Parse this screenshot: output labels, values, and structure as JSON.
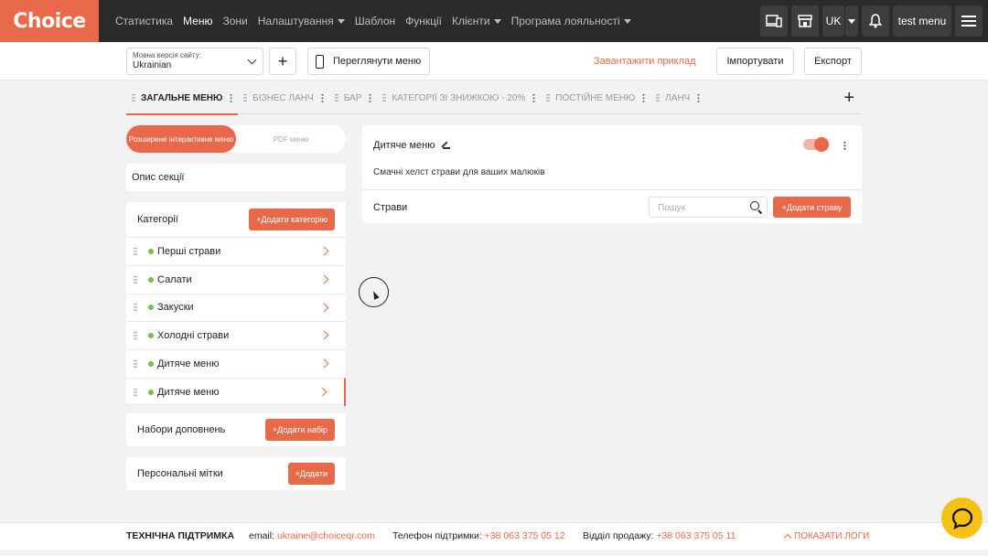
{
  "brand": {
    "logo_text": "Choice",
    "accent": "#e8694a"
  },
  "nav": {
    "items": [
      {
        "label": "Статистика",
        "active": false,
        "has_dropdown": false
      },
      {
        "label": "Меню",
        "active": true,
        "has_dropdown": false
      },
      {
        "label": "Зони",
        "active": false,
        "has_dropdown": false
      },
      {
        "label": "Налаштування",
        "active": false,
        "has_dropdown": true
      },
      {
        "label": "Шаблон",
        "active": false,
        "has_dropdown": false
      },
      {
        "label": "Функції",
        "active": false,
        "has_dropdown": false
      },
      {
        "label": "Клієнти",
        "active": false,
        "has_dropdown": true
      },
      {
        "label": "Програма лояльності",
        "active": false,
        "has_dropdown": true
      }
    ],
    "right": {
      "devices_icon": "devices-icon",
      "store_icon": "store-icon",
      "lang": "UK",
      "bell_icon": "bell-icon",
      "account": "test menu",
      "menu_icon": "hamburger-icon"
    }
  },
  "toolbar": {
    "lang_label": "Мовна версія сайту:",
    "lang_value": "Ukrainian",
    "add_symbol": "+",
    "view_menu": "Переглянути меню",
    "download_sample": "Завантажити приклад",
    "import": "Імпортувати",
    "export": "Експорт"
  },
  "tabs": [
    {
      "label": "Загальне меню",
      "active": true
    },
    {
      "label": "Бізнес ланч",
      "active": false
    },
    {
      "label": "Бар",
      "active": false
    },
    {
      "label": "Категорії зі знижкою - 20%",
      "active": false
    },
    {
      "label": "Постійне меню",
      "active": false
    },
    {
      "label": "Ланч",
      "active": false
    }
  ],
  "tab_add": "+",
  "mode_toggle": {
    "interactive": "Розширене інтерактивне меню",
    "pdf": "PDF меню"
  },
  "section_description": "Опис секції",
  "categories": {
    "title": "Категорії",
    "add_label": "+Додати категорію",
    "items": [
      {
        "label": "Перші страви",
        "selected": false
      },
      {
        "label": "Салати",
        "selected": false
      },
      {
        "label": "Закуски",
        "selected": false
      },
      {
        "label": "Холодні страви",
        "selected": false
      },
      {
        "label": "Дитяче меню",
        "selected": false
      },
      {
        "label": "Дитяче меню",
        "selected": true
      }
    ]
  },
  "addons": {
    "title": "Набори доповнень",
    "add_label": "+Додати набір"
  },
  "personal_labels": {
    "title": "Персональні мітки",
    "add_label": "+Додати"
  },
  "section": {
    "title": "Дитяче меню",
    "enabled": true,
    "description": "Смачні хелст страви для ваших малюків",
    "dishes_label": "Страви",
    "search_placeholder": "Пошук",
    "add_dish": "+Додати страву"
  },
  "footer": {
    "support_title": "ТЕХНІЧНА ПІДТРИМКА",
    "email_label": "email:",
    "email": "ukraine@choiceqr.com",
    "phone_label": "Телефон підтримки:",
    "phone": "+38 063 375 05 12",
    "sales_label": "Відділ продажу:",
    "sales_phone": "+38 063 375 05 11",
    "show_logs": "Показати логи"
  },
  "colors": {
    "accent": "#e8694a",
    "active_dot": "#6cc24a",
    "chat": "#f5c117",
    "nav_bg": "#2b2b2b"
  }
}
